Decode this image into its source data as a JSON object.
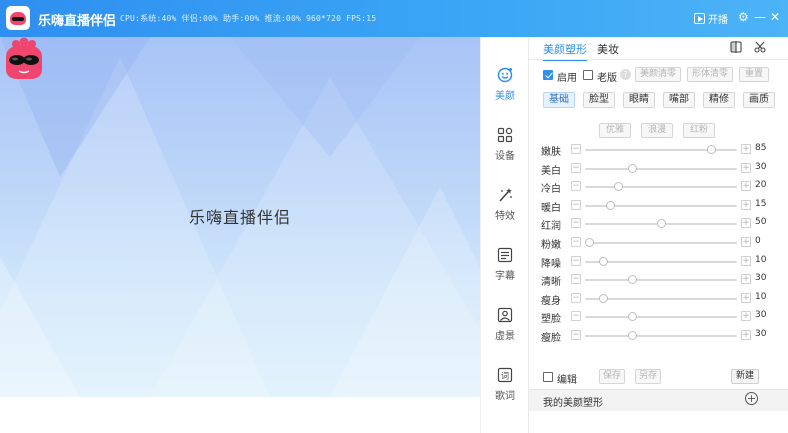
{
  "app": {
    "title": "乐嗨直播伴侣",
    "status": "CPU:系统:40% 伴侣:00% 助手:00% 推流:00% 960*720 FPS:15",
    "live_button": "开播",
    "settings_icon": "gear-icon",
    "minimize_icon": "minimize-icon",
    "close_icon": "close-icon"
  },
  "preview": {
    "title": "乐嗨直播伴侣",
    "colors": {
      "top": "#a8c4f7",
      "bottom": "#def1fc"
    }
  },
  "sidebar": {
    "items": [
      {
        "label": "美颜",
        "icon": "beauty-face-icon",
        "active": true
      },
      {
        "label": "设备",
        "icon": "device-grid-icon",
        "active": false
      },
      {
        "label": "特效",
        "icon": "effects-wand-icon",
        "active": false
      },
      {
        "label": "字幕",
        "icon": "subtitle-icon",
        "active": false
      },
      {
        "label": "虚景",
        "icon": "virtual-scene-icon",
        "active": false
      },
      {
        "label": "歌词",
        "icon": "lyrics-icon",
        "active": false
      }
    ]
  },
  "panel": {
    "tabs": [
      {
        "label": "美颜塑形",
        "active": true
      },
      {
        "label": "美妆",
        "active": false
      }
    ],
    "tab_icons": [
      "compare-icon",
      "scissors-icon"
    ],
    "enable_label": "启用",
    "enable_checked": true,
    "old_label": "老版",
    "old_checked": false,
    "help_icon": "question-icon",
    "top_buttons": [
      "美颜清零",
      "形体清零",
      "重置"
    ],
    "categories": [
      "基础",
      "脸型",
      "眼睛",
      "嘴部",
      "精修",
      "画质"
    ],
    "active_category": "基础",
    "sub_buttons": [
      "优雅",
      "浪漫",
      "红粉"
    ],
    "sliders": [
      {
        "name": "嫩肤",
        "value": 85
      },
      {
        "name": "美白",
        "value": 30
      },
      {
        "name": "冷白",
        "value": 20
      },
      {
        "name": "暖白",
        "value": 15
      },
      {
        "name": "红润",
        "value": 50
      },
      {
        "name": "粉嫩",
        "value": 0
      },
      {
        "name": "降噪",
        "value": 10
      },
      {
        "name": "清晰",
        "value": 30
      },
      {
        "name": "瘦身",
        "value": 10
      },
      {
        "name": "塑脸",
        "value": 30
      },
      {
        "name": "瘦脸",
        "value": 30
      }
    ],
    "edit_label": "编辑",
    "save_label": "保存",
    "save_as_label": "另存",
    "new_label": "新建",
    "preset_label": "我的美颜塑形",
    "accent": "#2f8ff0"
  }
}
